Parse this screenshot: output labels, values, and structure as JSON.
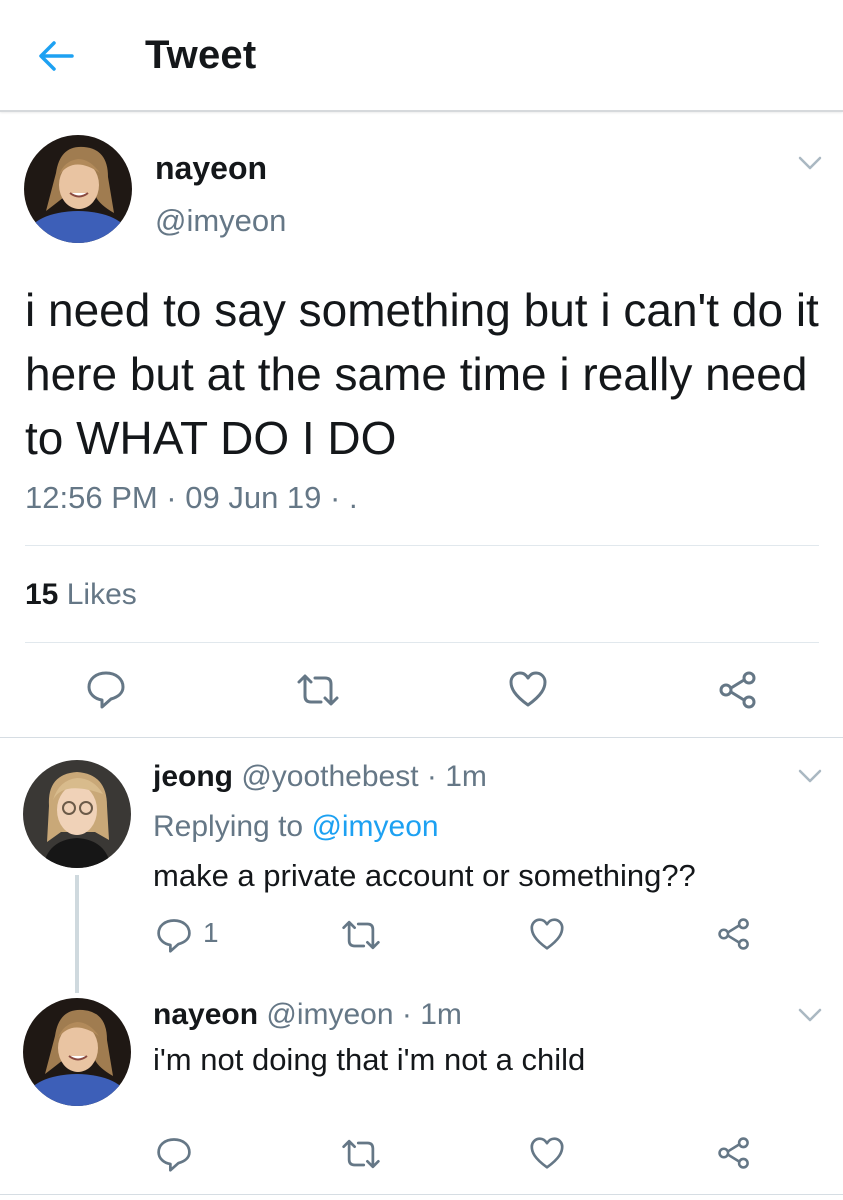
{
  "header": {
    "title": "Tweet",
    "back_icon": "arrow-left-icon"
  },
  "colors": {
    "accent": "#1da1f2",
    "secondary_text": "#657786",
    "primary_text": "#14171a",
    "divider": "#e1e8ed"
  },
  "main_tweet": {
    "author_name": "nayeon",
    "author_handle": "@imyeon",
    "text": "i need to say something but i can't do it here but at the same time i really need to WHAT DO I DO",
    "timestamp": "12:56 PM · 09 Jun 19 · .",
    "likes_count": "15",
    "likes_label": "Likes",
    "actions": [
      "reply-icon",
      "retweet-icon",
      "like-icon",
      "share-icon"
    ]
  },
  "replies": [
    {
      "name": "jeong",
      "handle": "@yoothebest",
      "time": "· 1m",
      "replying_prefix": "Replying to",
      "replying_to": "@imyeon",
      "text": "make a private account or something??",
      "reply_count": "1"
    },
    {
      "name": "nayeon",
      "handle": "@imyeon",
      "time": "· 1m",
      "text": "i'm not doing that i'm not a child"
    }
  ]
}
